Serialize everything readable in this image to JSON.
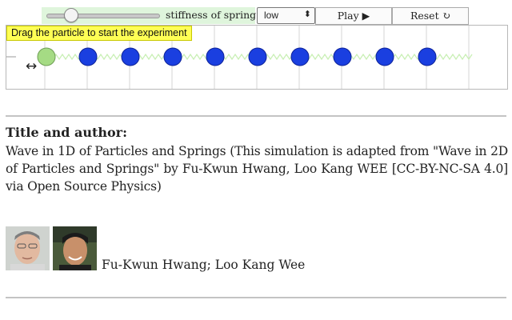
{
  "controls": {
    "slider_value": 0.18,
    "stiffness_label": "stiffness of spring:",
    "stiffness_selected": "low",
    "play_label": "Play ▶",
    "reset_label": "Reset ↻"
  },
  "simulation": {
    "tooltip": "Drag the particle to start the experiment",
    "drag_arrow": "↔",
    "particle_count": 10,
    "colors": {
      "particle": "#1a3fe0",
      "selected_particle": "#a5db84",
      "spring": "#c9efb5",
      "grid": "#d6d6d6"
    }
  },
  "info": {
    "heading": "Title and author:",
    "description": "Wave in 1D of Particles and Springs (This simulation is adapted from \"Wave in 2D of Particles and Springs\" by Fu-Kwun Hwang, Loo Kang WEE [CC-BY-NC-SA 4.0] via Open Source Physics)",
    "authors": "Fu-Kwun Hwang; Loo Kang Wee"
  }
}
